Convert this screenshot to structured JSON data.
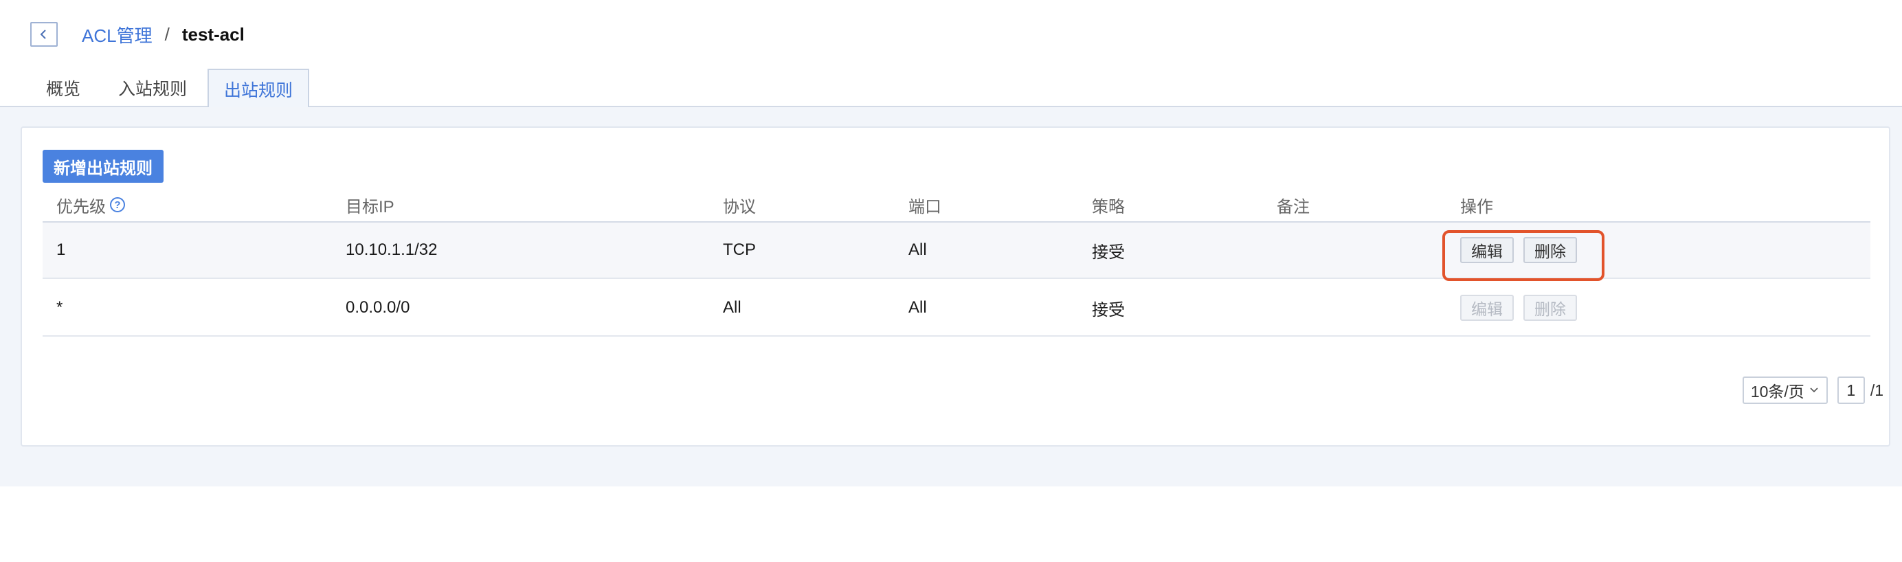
{
  "header": {
    "back_icon": "chevron-left-icon",
    "breadcrumb_parent": "ACL管理",
    "breadcrumb_separator": "/",
    "breadcrumb_current": "test-acl"
  },
  "tabs": [
    {
      "label": "概览",
      "active": false
    },
    {
      "label": "入站规则",
      "active": false
    },
    {
      "label": "出站规则",
      "active": true
    }
  ],
  "toolbar": {
    "add_label": "新增出站规则"
  },
  "table": {
    "columns": [
      "优先级",
      "目标IP",
      "协议",
      "端口",
      "策略",
      "备注",
      "操作"
    ],
    "help_icon": "question-circle-icon",
    "rows": [
      {
        "priority": "1",
        "target_ip": "10.10.1.1/32",
        "protocol": "TCP",
        "port": "All",
        "policy": "接受",
        "remark": "",
        "edit": "编辑",
        "delete": "删除",
        "actions_enabled": true,
        "highlighted": true
      },
      {
        "priority": "*",
        "target_ip": "0.0.0.0/0",
        "protocol": "All",
        "port": "All",
        "policy": "接受",
        "remark": "",
        "edit": "编辑",
        "delete": "删除",
        "actions_enabled": false,
        "highlighted": false
      }
    ]
  },
  "pagination": {
    "page_size": "10条/页",
    "current_page": "1",
    "total_pages": "/1"
  },
  "colors": {
    "accent": "#4a82e0",
    "link": "#3e74d8",
    "highlight": "#e2532b"
  }
}
